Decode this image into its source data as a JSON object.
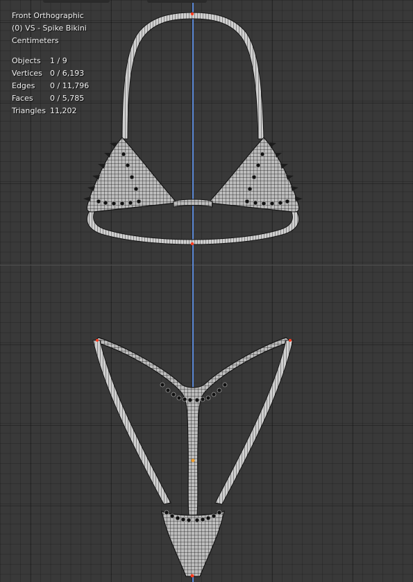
{
  "viewport": {
    "view_name": "Front Orthographic",
    "collection_label": "(0) VS - Spike Bikini",
    "units": "Centimeters",
    "stats": [
      {
        "label": "Objects",
        "value": "1 / 9"
      },
      {
        "label": "Vertices",
        "value": "0 / 6,193"
      },
      {
        "label": "Edges",
        "value": "0 / 11,796"
      },
      {
        "label": "Faces",
        "value": "0 / 5,785"
      },
      {
        "label": "Triangles",
        "value": "11,202"
      }
    ]
  },
  "colors": {
    "background": "#393939",
    "z_axis": "#5b88d6",
    "mesh_dark": "#161616",
    "mesh_light": "#c8c8c8",
    "selected_vertex": "#ff3b1e",
    "origin": "#f0a030"
  }
}
